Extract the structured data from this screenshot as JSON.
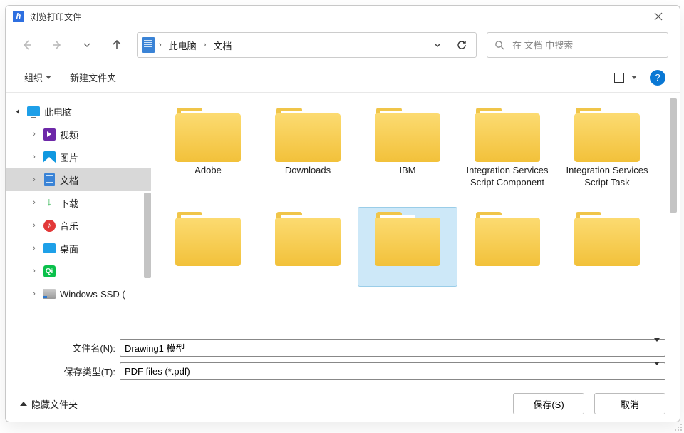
{
  "title": "浏览打印文件",
  "breadcrumbs": [
    "此电脑",
    "文档"
  ],
  "search": {
    "placeholder": "在 文档 中搜索"
  },
  "toolbar": {
    "organize": "组织",
    "new_folder": "新建文件夹"
  },
  "tree": {
    "root": "此电脑",
    "items": [
      {
        "label": "视频",
        "icon": "video"
      },
      {
        "label": "图片",
        "icon": "pic"
      },
      {
        "label": "文档",
        "icon": "doc",
        "selected": true
      },
      {
        "label": "下载",
        "icon": "dl"
      },
      {
        "label": "音乐",
        "icon": "music"
      },
      {
        "label": "桌面",
        "icon": "desk"
      },
      {
        "label": "",
        "icon": "iqiyi"
      },
      {
        "label": "Windows-SSD (",
        "icon": "ssd"
      }
    ]
  },
  "folders_row1": [
    {
      "label": "Adobe"
    },
    {
      "label": "Downloads"
    },
    {
      "label": "IBM"
    },
    {
      "label": "Integration Services Script Component"
    },
    {
      "label": "Integration Services Script Task"
    }
  ],
  "folders_row2_selected_index": 2,
  "form": {
    "filename_label": "文件名(N):",
    "filename_value": "Drawing1 模型",
    "type_label": "保存类型(T):",
    "type_value": "PDF files (*.pdf)"
  },
  "footer": {
    "hide_folders": "隐藏文件夹",
    "save": "保存(S)",
    "cancel": "取消"
  }
}
